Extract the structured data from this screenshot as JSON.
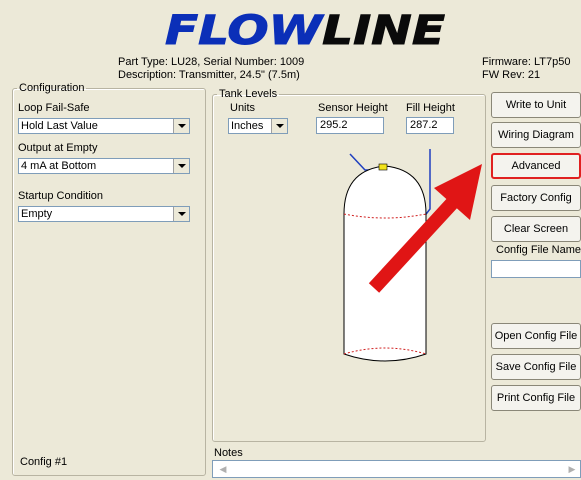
{
  "logo_text": "FLOWLINE",
  "header": {
    "part_type": "Part Type:  LU28, Serial Number:  1009",
    "description": "Description: Transmitter, 24.5\" (7.5m)",
    "firmware": "Firmware: LT7p50",
    "fw_rev": "FW Rev: 21"
  },
  "configuration": {
    "legend": "Configuration",
    "loop_failsafe_label": "Loop Fail-Safe",
    "loop_failsafe_value": "Hold Last Value",
    "output_empty_label": "Output at Empty",
    "output_empty_value": "4 mA at Bottom",
    "startup_label": "Startup Condition",
    "startup_value": "Empty"
  },
  "tank_levels": {
    "legend": "Tank Levels",
    "units_label": "Units",
    "units_value": "Inches",
    "sensor_height_label": "Sensor Height",
    "sensor_height_value": "295.2",
    "fill_height_label": "Fill Height",
    "fill_height_value": "287.2"
  },
  "buttons": {
    "write_to_unit": "Write to Unit",
    "wiring_diagram": "Wiring Diagram",
    "advanced": "Advanced",
    "factory_config": "Factory Config",
    "clear_screen": "Clear Screen",
    "open_config_file": "Open Config File",
    "save_config_file": "Save Config File",
    "print_config_file": "Print Config File"
  },
  "config_file_name_label": "Config File Name",
  "config_file_name_value": "",
  "notes_label": "Notes",
  "config_number": "Config #1",
  "colors": {
    "logo_blue": "#0b2fb8",
    "logo_black": "#0a0a0a",
    "arrow_red": "#e01515",
    "panel_bg": "#ece9d8"
  },
  "icons": {
    "annotation": "red-arrow-icon",
    "tank": "tank-diagram-icon"
  }
}
